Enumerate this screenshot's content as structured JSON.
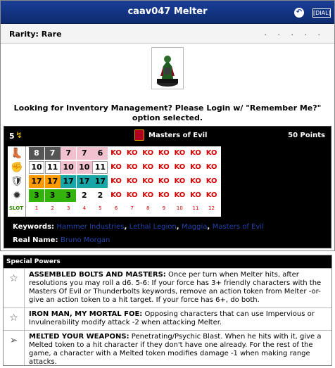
{
  "header": {
    "title": "caav047 Melter",
    "dial_label": "[DIAL]",
    "back_icon": "back-arrow-icon"
  },
  "rarity": "Rarity: Rare",
  "dots": ". . . . .",
  "login_message": "Looking for Inventory Management? Please Login w/ \"Remember Me?\" option selected.",
  "card": {
    "range": "5",
    "team": "Masters of Evil",
    "points": "50 Points",
    "slot_label": "SLOT",
    "dial": {
      "speed": [
        "8",
        "7",
        "7",
        "7",
        "6",
        "KO",
        "KO",
        "KO",
        "KO",
        "KO",
        "KO",
        "KO"
      ],
      "attack": [
        "10",
        "11",
        "10",
        "10",
        "11",
        "KO",
        "KO",
        "KO",
        "KO",
        "KO",
        "KO",
        "KO"
      ],
      "defense": [
        "17",
        "17",
        "17",
        "17",
        "17",
        "KO",
        "KO",
        "KO",
        "KO",
        "KO",
        "KO",
        "KO"
      ],
      "damage": [
        "3",
        "3",
        "3",
        "2",
        "2",
        "KO",
        "KO",
        "KO",
        "KO",
        "KO",
        "KO",
        "KO"
      ],
      "slots": [
        "1",
        "2",
        "3",
        "4",
        "5",
        "6",
        "7",
        "8",
        "9",
        "10",
        "11",
        "12"
      ]
    },
    "keywords_label": "Keywords:",
    "keywords": [
      "Hammer Industries",
      "Lethal Legion",
      "Maggia",
      "Masters of Evil"
    ],
    "realname_label": "Real Name:",
    "realname": "Bruno Morgan"
  },
  "powers": {
    "heading": "Special Powers",
    "items": [
      {
        "name": "ASSEMBLED BOLTS AND MASTERS:",
        "text": " Once per turn when Melter hits, after resolutions you may roll a d6. 5-6: If your force has 3+ friendly characters with the Masters Of Evil or Thunderbolts keywords, remove an action token from Melter -or- give an action token to a hit target. If your force has 6+, do both.",
        "icon": "star-icon"
      },
      {
        "name": "IRON MAN, MY MORTAL FOE:",
        "text": " Opposing characters that can use Impervious or Invulnerability modify attack -2 when attacking Melter.",
        "icon": "star-icon"
      },
      {
        "name": "MELTED YOUR WEAPONS:",
        "text": " Penetrating/Psychic Blast. When he hits with it, give a Melted token to a hit character if they don't have one already. For the rest of the game, a character with a Melted token modifies damage -1 when making range attacks.",
        "icon": "blaster-icon"
      }
    ]
  }
}
